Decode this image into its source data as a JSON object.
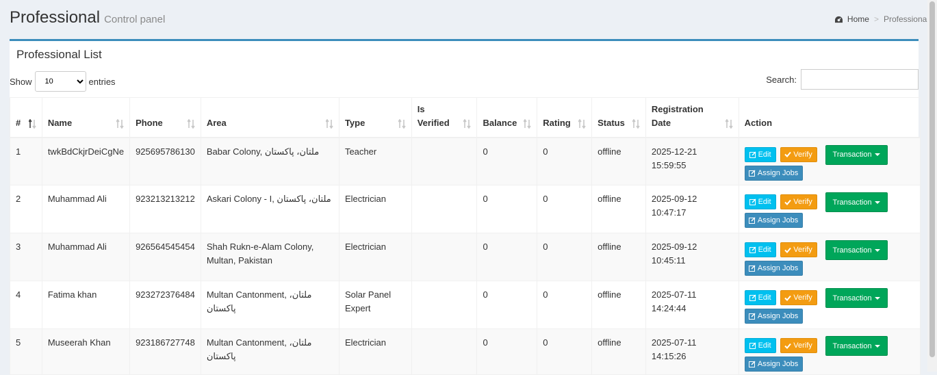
{
  "header": {
    "title": "Professional",
    "subtitle": "Control panel",
    "breadcrumb": {
      "home": "Home",
      "separator": ">",
      "current": "Professional"
    }
  },
  "box": {
    "title": "Professional List"
  },
  "length": {
    "show": "Show",
    "value": "10",
    "entries": "entries"
  },
  "search": {
    "label": "Search:",
    "value": ""
  },
  "columns": [
    {
      "line1": "#",
      "line2": ""
    },
    {
      "line1": "Name",
      "line2": ""
    },
    {
      "line1": "Phone",
      "line2": ""
    },
    {
      "line1": "Area",
      "line2": ""
    },
    {
      "line1": "Type",
      "line2": ""
    },
    {
      "line1": "Is",
      "line2": "Verified"
    },
    {
      "line1": "Balance",
      "line2": ""
    },
    {
      "line1": "Rating",
      "line2": ""
    },
    {
      "line1": "Status",
      "line2": ""
    },
    {
      "line1": "Registration",
      "line2": "Date"
    },
    {
      "line1": "Action",
      "line2": ""
    }
  ],
  "actions": {
    "edit": "Edit",
    "verify": "Verify",
    "assign": "Assign Jobs",
    "transaction": "Transaction"
  },
  "rows": [
    {
      "num": "1",
      "name": "twkBdCkjrDeiCgNe",
      "phone": "925695786130",
      "area": "Babar Colony, ملتان، پاکستان",
      "type": "Teacher",
      "verified": "",
      "balance": "0",
      "rating": "0",
      "status": "offline",
      "date": "2025-12-21 15:59:55"
    },
    {
      "num": "2",
      "name": "Muhammad Ali",
      "phone": "923213213212",
      "area": "Askari Colony - I, ملتان، پاکستان",
      "type": "Electrician",
      "verified": "",
      "balance": "0",
      "rating": "0",
      "status": "offline",
      "date": "2025-09-12 10:47:17"
    },
    {
      "num": "3",
      "name": "Muhammad Ali",
      "phone": "926564545454",
      "area": "Shah Rukn-e-Alam Colony, Multan, Pakistan",
      "type": "Electrician",
      "verified": "",
      "balance": "0",
      "rating": "0",
      "status": "offline",
      "date": "2025-09-12 10:45:11"
    },
    {
      "num": "4",
      "name": "Fatima khan",
      "phone": "923272376484",
      "area": "Multan Cantonment, ملتان، پاکستان",
      "type": "Solar Panel Expert",
      "verified": "",
      "balance": "0",
      "rating": "0",
      "status": "offline",
      "date": "2025-07-11 14:24:44"
    },
    {
      "num": "5",
      "name": "Museerah Khan",
      "phone": "923186727748",
      "area": "Multan Cantonment, ملتان، پاکستان",
      "type": "Electrician",
      "verified": "",
      "balance": "0",
      "rating": "0",
      "status": "offline",
      "date": "2025-07-11 14:15:26"
    }
  ],
  "colors": {
    "accent": "#3c8dbc",
    "edit": "#00c0ef",
    "verify": "#f39c12",
    "transaction": "#00a65a",
    "assign": "#3c8dbc"
  },
  "icons": {
    "home": "dashboard-icon",
    "sort": "sort-icon",
    "edit": "edit-icon",
    "verify": "check-icon",
    "caret": "caret-down-icon"
  }
}
